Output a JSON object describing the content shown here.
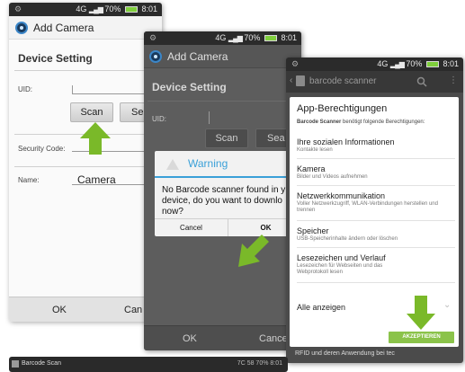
{
  "shot1": {
    "status_time": "8:01",
    "status_battery": "70%",
    "status_network": "4G",
    "title": "Add Camera",
    "section": "Device Setting",
    "uid_label": "UID:",
    "scan_label": "Scan",
    "se_label": "Se",
    "security_label": "Security Code:",
    "name_label": "Name:",
    "name_value": "Camera",
    "ok_label": "OK",
    "cancel_label": "Can"
  },
  "shot2": {
    "status_time": "8:01",
    "status_battery": "70%",
    "status_network": "4G",
    "title": "Add Camera",
    "section": "Device Setting",
    "uid_label": "UID:",
    "scan_label": "Scan",
    "sea_label": "Sea",
    "ok_label": "OK",
    "cancel_label": "Cance",
    "dialog": {
      "title": "Warning",
      "message_line1": "No Barcode scanner found in y",
      "message_line2": "device, do you want to downlo",
      "message_line3": "now?",
      "cancel": "Cancel",
      "ok": "OK"
    }
  },
  "shot3": {
    "status_time": "8:01",
    "status_battery": "70%",
    "status_network": "4G",
    "app_title": "barcode scanner",
    "heading": "App-Berechtigungen",
    "subtitle_bold": "Barcode Scanner",
    "subtitle_rest": " benötigt folgende Berechtigungen:",
    "permissions": [
      {
        "title": "Ihre sozialen Informationen",
        "desc": "Kontakte lesen"
      },
      {
        "title": "Kamera",
        "desc": "Bilder und Videos aufnehmen"
      },
      {
        "title": "Netzwerkkommunikation",
        "desc": "Voller Netzwerkzugriff, WLAN-Verbindungen herstellen und trennen"
      },
      {
        "title": "Speicher",
        "desc": "USB-Speicherinhalte ändern oder löschen"
      },
      {
        "title": "Lesezeichen und Verlauf",
        "desc": "Lesezeichen für Webseiten und das Webprotokoll lesen"
      }
    ],
    "show_all": "Alle anzeigen",
    "accept": "AKZEPTIEREN",
    "below_text": "RFID und deren Anwendung bei tec"
  },
  "strip": {
    "title": "Barcode Scan",
    "status": "7C 58 70%  8:01"
  },
  "colors": {
    "accent_green": "#7ab929",
    "dialog_blue": "#3aa0d8",
    "accept_green": "#8bc34a"
  }
}
